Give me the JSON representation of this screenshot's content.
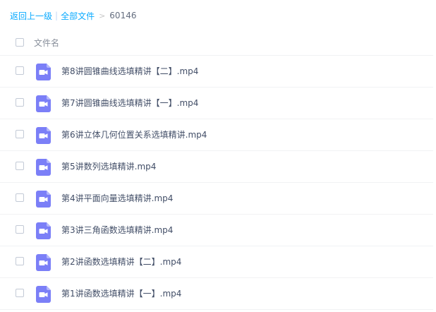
{
  "breadcrumb": {
    "back": "返回上一级",
    "separator": "|",
    "all_files": "全部文件",
    "arrow": ">",
    "current": "60146"
  },
  "header": {
    "column_name": "文件名"
  },
  "file_icon": "video-file-icon",
  "colors": {
    "link": "#09aaff",
    "icon_purple": "#7b7ff7",
    "text": "#424e67"
  },
  "files": [
    {
      "name": "第8讲圆锥曲线选填精讲【二】.mp4"
    },
    {
      "name": "第7讲圆锥曲线选填精讲【一】.mp4"
    },
    {
      "name": "第6讲立体几何位置关系选填精讲.mp4"
    },
    {
      "name": "第5讲数列选填精讲.mp4"
    },
    {
      "name": "第4讲平面向量选填精讲.mp4"
    },
    {
      "name": "第3讲三角函数选填精讲.mp4"
    },
    {
      "name": "第2讲函数选填精讲【二】.mp4"
    },
    {
      "name": "第1讲函数选填精讲【一】.mp4"
    }
  ]
}
